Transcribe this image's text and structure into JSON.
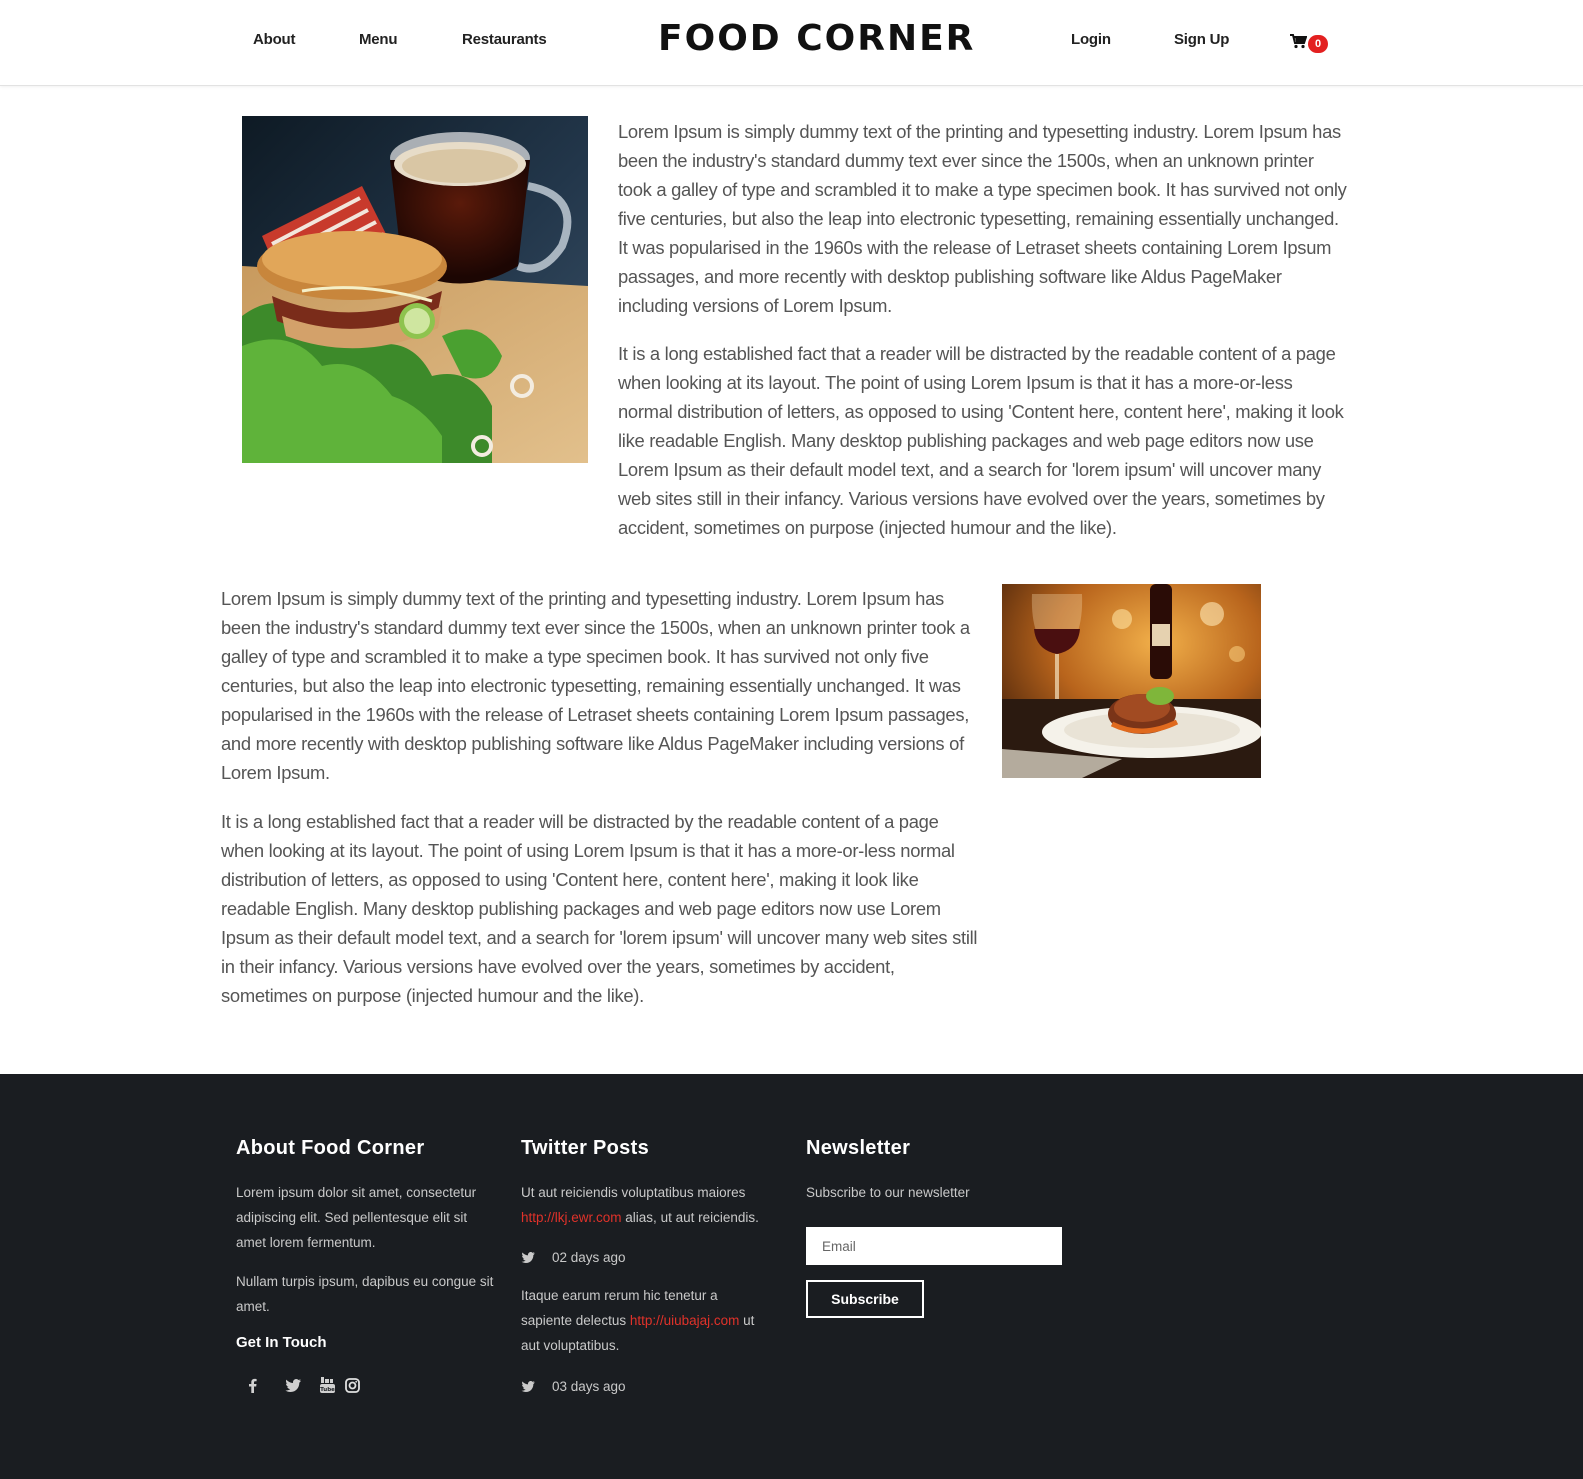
{
  "header": {
    "nav_left": [
      "About",
      "Menu",
      "Restaurants"
    ],
    "logo": "FOOD CORNER",
    "nav_right": [
      "Login",
      "Sign Up"
    ],
    "cart_count": "0",
    "cart_icon": "cart-icon"
  },
  "section1": {
    "image_alt": "sandwich-and-coffee-photo",
    "paragraphs": [
      "Lorem Ipsum is simply dummy text of the printing and typesetting industry. Lorem Ipsum has been the industry's standard dummy text ever since the 1500s, when an unknown printer took a galley of type and scrambled it to make a type specimen book. It has survived not only five centuries, but also the leap into electronic typesetting, remaining essentially unchanged. It was popularised in the 1960s with the release of Letraset sheets containing Lorem Ipsum passages, and more recently with desktop publishing software like Aldus PageMaker including versions of Lorem Ipsum.",
      "It is a long established fact that a reader will be distracted by the readable content of a page when looking at its layout. The point of using Lorem Ipsum is that it has a more-or-less normal distribution of letters, as opposed to using 'Content here, content here', making it look like readable English. Many desktop publishing packages and web page editors now use Lorem Ipsum as their default model text, and a search for 'lorem ipsum' will uncover many web sites still in their infancy. Various versions have evolved over the years, sometimes by accident, sometimes on purpose (injected humour and the like)."
    ]
  },
  "section2": {
    "image_alt": "steak-dinner-and-wine-photo",
    "paragraphs": [
      "Lorem Ipsum is simply dummy text of the printing and typesetting industry. Lorem Ipsum has been the industry's standard dummy text ever since the 1500s, when an unknown printer took a galley of type and scrambled it to make a type specimen book. It has survived not only five centuries, but also the leap into electronic typesetting, remaining essentially unchanged. It was popularised in the 1960s with the release of Letraset sheets containing Lorem Ipsum passages, and more recently with desktop publishing software like Aldus PageMaker including versions of Lorem Ipsum.",
      "It is a long established fact that a reader will be distracted by the readable content of a page when looking at its layout. The point of using Lorem Ipsum is that it has a more-or-less normal distribution of letters, as opposed to using 'Content here, content here', making it look like readable English. Many desktop publishing packages and web page editors now use Lorem Ipsum as their default model text, and a search for 'lorem ipsum' will uncover many web sites still in their infancy. Various versions have evolved over the years, sometimes by accident, sometimes on purpose (injected humour and the like)."
    ]
  },
  "footer": {
    "about": {
      "title": "About Food Corner",
      "text1": "Lorem ipsum dolor sit amet, consectetur adipiscing elit. Sed pellentesque elit sit amet lorem fermentum.",
      "text2": "Nullam turpis ipsum, dapibus eu congue sit amet.",
      "get_in_touch": "Get In Touch",
      "socials": [
        "facebook-icon",
        "twitter-icon",
        "youtube-icon",
        "instagram-icon"
      ]
    },
    "twitter": {
      "title": "Twitter Posts",
      "posts": [
        {
          "before": "Ut aut reiciendis voluptatibus maiores ",
          "link": "http://lkj.ewr.com",
          "after": " alias, ut aut reiciendis.",
          "time": "02 days ago"
        },
        {
          "before": "Itaque earum rerum hic tenetur a sapiente delectus ",
          "link": "http://uiubajaj.com",
          "after": " ut aut voluptatibus.",
          "time": "03 days ago"
        }
      ]
    },
    "newsletter": {
      "title": "Newsletter",
      "text": "Subscribe to our newsletter",
      "email_placeholder": "Email",
      "button": "Subscribe"
    }
  },
  "colors": {
    "footer_bg": "#1a1d21",
    "accent_red": "#e0322a",
    "badge_red": "#e32020"
  }
}
